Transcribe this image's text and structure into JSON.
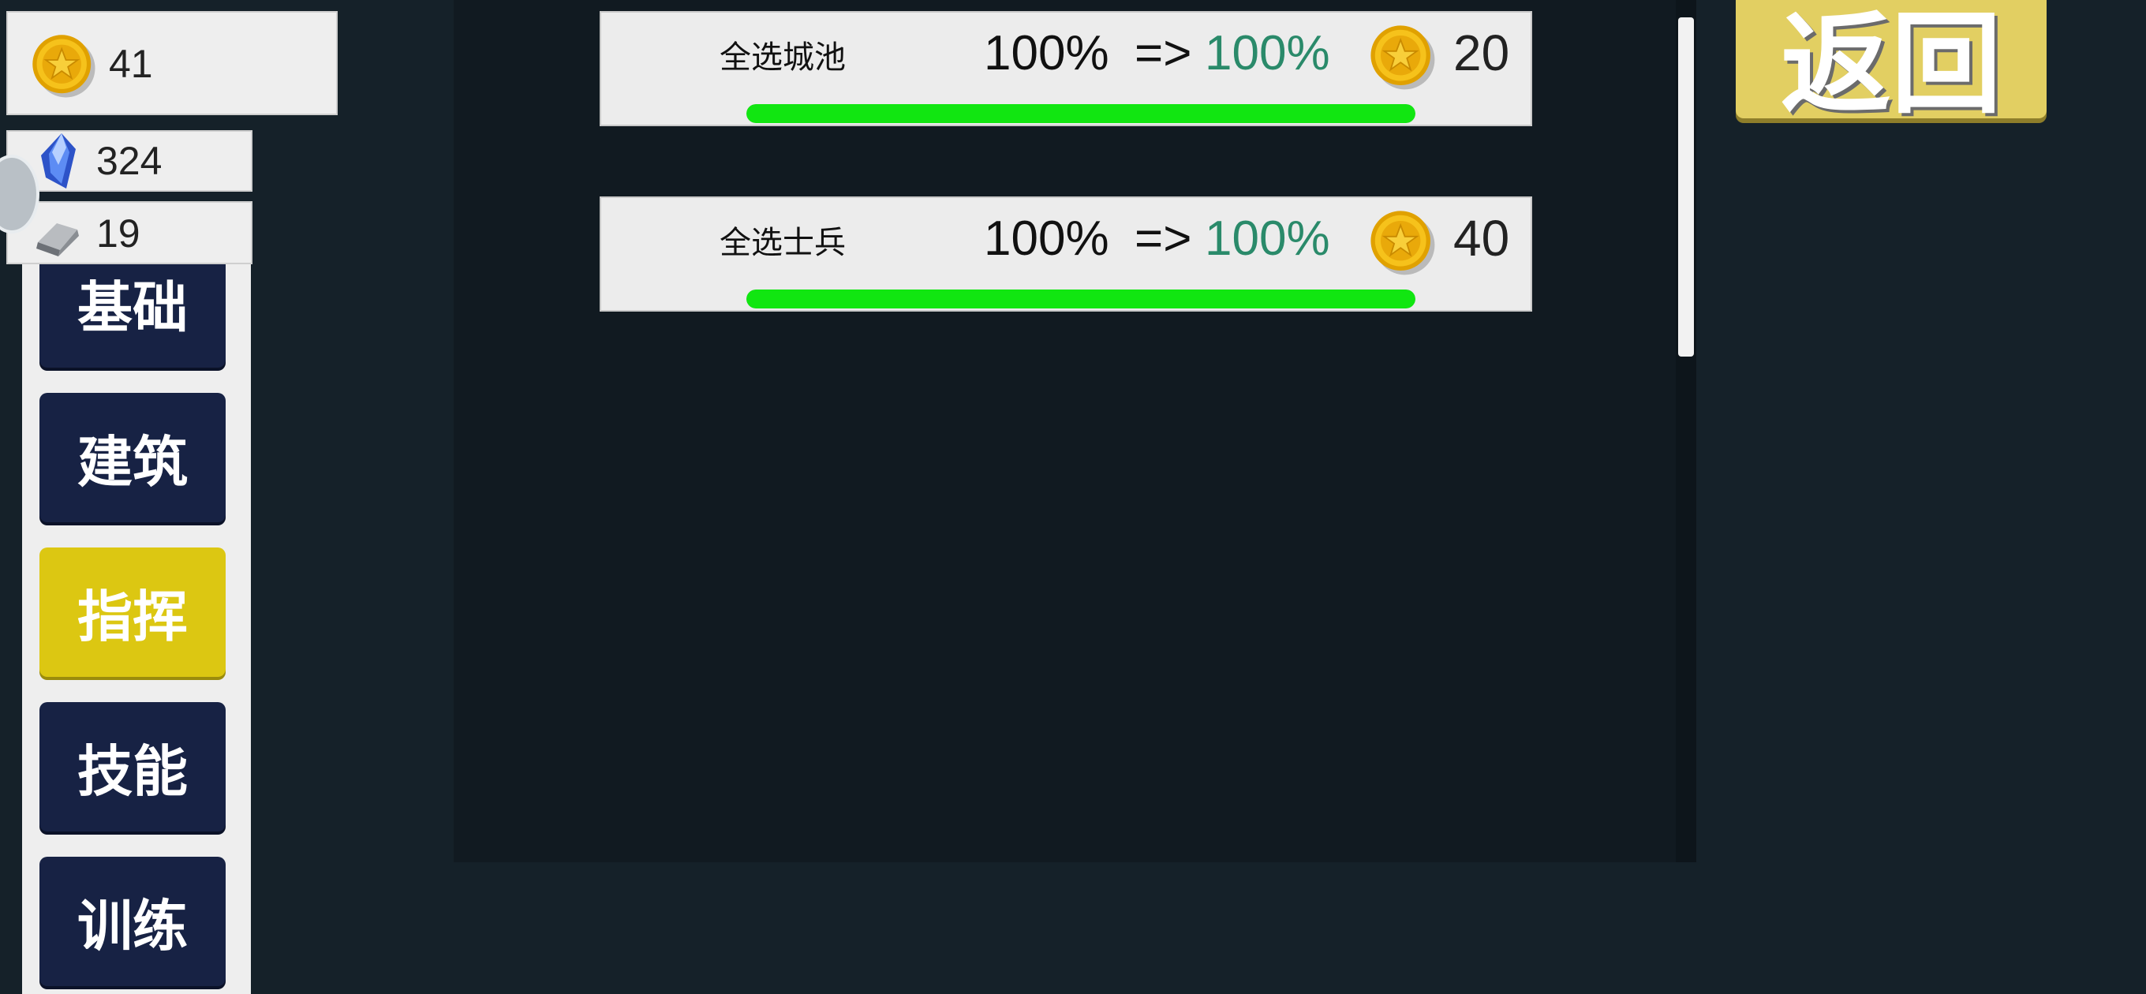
{
  "resources": {
    "gold": "41",
    "gem": "324",
    "iron": "19"
  },
  "nav": {
    "items": [
      {
        "label": "基础"
      },
      {
        "label": "建筑"
      },
      {
        "label": "指挥"
      },
      {
        "label": "技能"
      },
      {
        "label": "训练"
      }
    ],
    "active_index": 2
  },
  "upgrades": [
    {
      "name": "全选城池",
      "from": "100%",
      "arrow": "=>",
      "to": "100%",
      "cost": "20",
      "progress": 1.0
    },
    {
      "name": "全选士兵",
      "from": "100%",
      "arrow": "=>",
      "to": "100%",
      "cost": "40",
      "progress": 1.0
    }
  ],
  "return_label": "返回",
  "colors": {
    "background": "#152129",
    "panel": "#111a21",
    "nav_button": "#172244",
    "nav_active": "#dcc712",
    "progress_fill": "#11e611",
    "target_value": "#2a8a6a",
    "return_button": "#e2cf62"
  },
  "icons": {
    "gold": "gold-coin-icon",
    "gem": "blue-crystal-icon",
    "iron": "iron-ingot-icon"
  }
}
